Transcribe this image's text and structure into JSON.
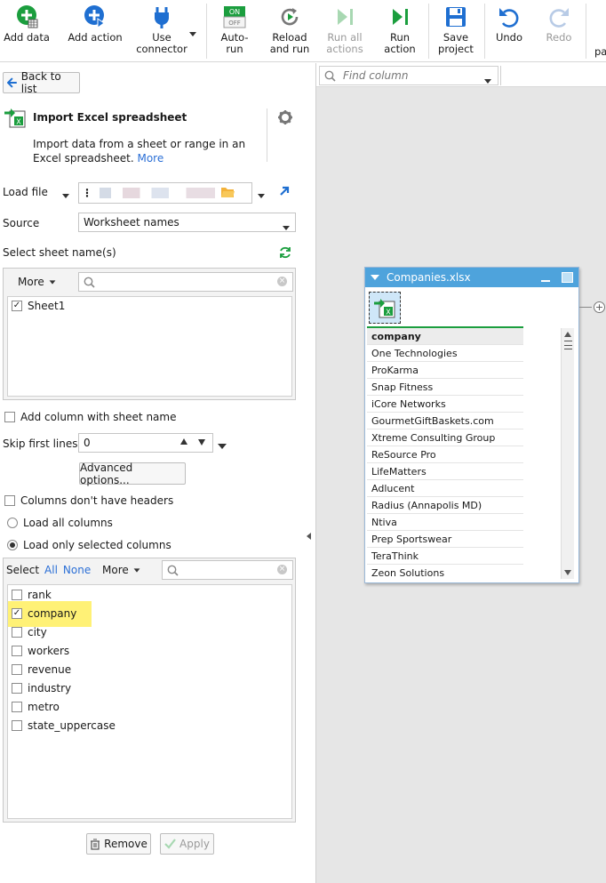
{
  "toolbar": {
    "add_data": "Add data",
    "add_action": "Add action",
    "use_connector": "Use\nconnector",
    "auto_run": "Auto-\nrun",
    "auto_run_on": "ON",
    "auto_run_off": "OFF",
    "reload_run": "Reload\nand run",
    "run_all": "Run all\nactions",
    "run_action": "Run\naction",
    "save_project": "Save\nproject",
    "undo": "Undo",
    "redo": "Redo",
    "cut_off": "pa"
  },
  "panel": {
    "back": "Back to list",
    "title": "Import Excel spreadsheet",
    "description": "Import data from a sheet or range in an Excel spreadsheet.",
    "more_link": "More",
    "load_file_label": "Load file",
    "source_label": "Source",
    "source_value": "Worksheet names",
    "select_sheet_label": "Select sheet name(s)",
    "sheet_more": "More",
    "sheets": [
      {
        "name": "Sheet1",
        "checked": true
      }
    ],
    "add_column_sheet": "Add column with sheet name",
    "skip_label": "Skip first lines",
    "skip_value": "0",
    "advanced": "Advanced options...",
    "no_headers": "Columns don't have headers",
    "load_all": "Load all columns",
    "load_selected": "Load only selected columns",
    "select_label": "Select",
    "select_all": "All",
    "select_none": "None",
    "columns_more": "More",
    "columns": [
      {
        "name": "rank",
        "checked": false
      },
      {
        "name": "company",
        "checked": true
      },
      {
        "name": "city",
        "checked": false
      },
      {
        "name": "workers",
        "checked": false
      },
      {
        "name": "revenue",
        "checked": false
      },
      {
        "name": "industry",
        "checked": false
      },
      {
        "name": "metro",
        "checked": false
      },
      {
        "name": "state_uppercase",
        "checked": false
      }
    ],
    "remove": "Remove",
    "apply": "Apply",
    "highlight_color": "#fff176"
  },
  "canvas": {
    "find_placeholder": "Find column",
    "node_title": "Companies.xlsx",
    "column_header": "company",
    "rows": [
      "One Technologies",
      "ProKarma",
      "Snap Fitness",
      "iCore Networks",
      "GourmetGiftBaskets.com",
      "Xtreme Consulting Group",
      "ReSource Pro",
      "LifeMatters",
      "Adlucent",
      "Radius (Annapolis MD)",
      "Ntiva",
      "Prep Sportswear",
      "TeraThink",
      "Zeon Solutions"
    ]
  },
  "colors": {
    "accent_blue": "#1f6fd1",
    "green": "#1b9e3e",
    "node_header": "#4ea3dc"
  }
}
